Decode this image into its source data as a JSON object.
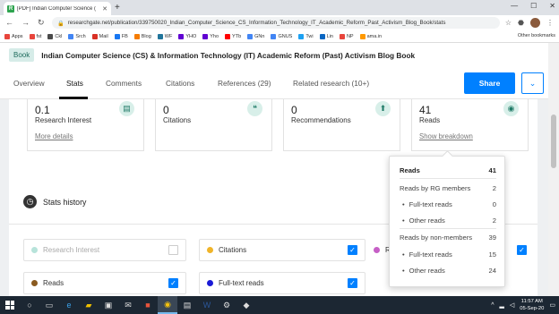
{
  "browser": {
    "tab_title": "[PDF] Indian Computer Science (",
    "url": "researchgate.net/publication/339750020_Indian_Computer_Science_CS_Information_Technology_IT_Academic_Reform_Past_Activism_Blog_Book/stats",
    "bookmarks": [
      {
        "label": "Apps",
        "color": "#e8453c"
      },
      {
        "label": "fst",
        "color": "#e8453c"
      },
      {
        "label": "Ckl",
        "color": "#4a4a4a"
      },
      {
        "label": "Srch",
        "color": "#4285f4"
      },
      {
        "label": "Mail",
        "color": "#d93025"
      },
      {
        "label": "FB",
        "color": "#1877f2"
      },
      {
        "label": "Blog",
        "color": "#f57c00"
      },
      {
        "label": "WF",
        "color": "#21759b"
      },
      {
        "label": "YHO",
        "color": "#6001d2"
      },
      {
        "label": "Yho",
        "color": "#6001d2"
      },
      {
        "label": "YTb",
        "color": "#ff0000"
      },
      {
        "label": "GNn",
        "color": "#4285f4"
      },
      {
        "label": "GNUS",
        "color": "#4285f4"
      },
      {
        "label": "Twi",
        "color": "#1da1f2"
      },
      {
        "label": "Lin",
        "color": "#0a66c2"
      },
      {
        "label": "NP",
        "color": "#e8453c"
      },
      {
        "label": "ama.in",
        "color": "#ff9900"
      }
    ],
    "other_bookmarks": "Other bookmarks"
  },
  "header": {
    "type_badge": "Book",
    "title": "Indian Computer Science (CS) & Information Technology (IT) Academic Reform (Past) Activism Blog Book",
    "tabs": [
      {
        "label": "Overview"
      },
      {
        "label": "Stats"
      },
      {
        "label": "Comments"
      },
      {
        "label": "Citations"
      },
      {
        "label": "References (29)"
      },
      {
        "label": "Related research (10+)"
      }
    ],
    "share_label": "Share"
  },
  "stats": [
    {
      "value": "0.1",
      "label": "Research Interest",
      "link": "More details",
      "icon": "chart-icon"
    },
    {
      "value": "0",
      "label": "Citations",
      "link": "",
      "icon": "quote-icon"
    },
    {
      "value": "0",
      "label": "Recommendations",
      "link": "",
      "icon": "arrow-up-icon"
    },
    {
      "value": "41",
      "label": "Reads",
      "link": "Show breakdown",
      "icon": "eye-icon"
    }
  ],
  "history": {
    "title": "Stats history",
    "series": [
      {
        "name": "Research Interest",
        "color": "#b7e3da",
        "checked": false
      },
      {
        "name": "Citations",
        "color": "#f0b429",
        "checked": true
      },
      {
        "name": "R",
        "color": "#c65fc6",
        "checked": true
      },
      {
        "name": "Reads",
        "color": "#8a5a1f",
        "checked": true
      },
      {
        "name": "Full-text reads",
        "color": "#1a1ad6",
        "checked": true
      }
    ]
  },
  "breakdown": {
    "rows": [
      {
        "label": "Reads",
        "value": "41"
      },
      {
        "label": "Reads by RG members",
        "value": "2"
      },
      {
        "label": "Full-text reads",
        "value": "0"
      },
      {
        "label": "Other reads",
        "value": "2"
      },
      {
        "label": "Reads by non-members",
        "value": "39"
      },
      {
        "label": "Full-text reads",
        "value": "15"
      },
      {
        "label": "Other reads",
        "value": "24"
      }
    ]
  },
  "taskbar": {
    "time": "11:57 AM",
    "date": "05-Sep-20"
  }
}
